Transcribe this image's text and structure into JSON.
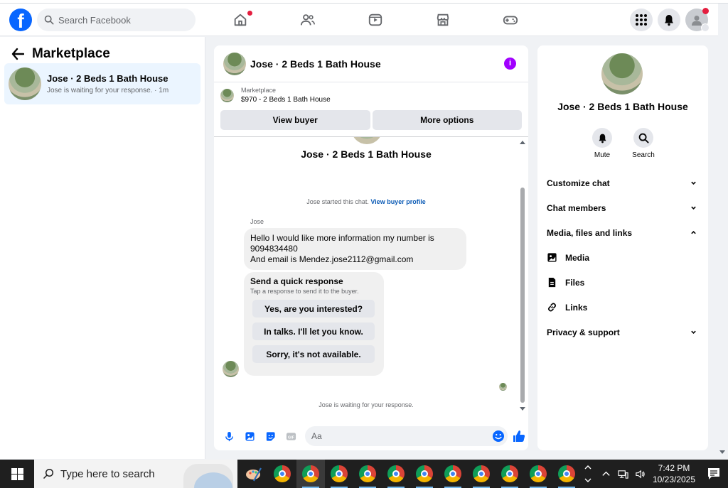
{
  "topnav": {
    "logo": "f",
    "search_placeholder": "Search Facebook"
  },
  "left": {
    "title": "Marketplace",
    "chat_item": {
      "title": "Jose · 2 Beds 1 Bath House",
      "subtitle": "Jose is waiting for your response. · 1m"
    }
  },
  "center": {
    "header_title": "Jose · 2 Beds 1 Bath House",
    "info_icon": "i",
    "listing_label": "Marketplace",
    "listing_price": "$970 - 2 Beds 1 Bath House",
    "view_buyer": "View buyer",
    "more_options": "More options",
    "conversation_name": "Jose · 2 Beds 1 Bath House",
    "started_text": "Jose started this chat.",
    "view_buyer_profile": "View buyer profile",
    "sender_name": "Jose",
    "message_lines": [
      "Hello I would like more information my number is",
      "9094834480",
      "And email is Mendez.jose2112@gmail.com"
    ],
    "quick_title": "Send a quick response",
    "quick_sub": "Tap a response to send it to the buyer.",
    "quick_replies": [
      "Yes, are you interested?",
      "In talks. I'll let you know.",
      "Sorry, it's not available."
    ],
    "waiting_text": "Jose is waiting for your response.",
    "composer_placeholder": "Aa"
  },
  "right": {
    "title": "Jose · 2 Beds 1 Bath House",
    "mute": "Mute",
    "search": "Search",
    "menu": {
      "customize": "Customize chat",
      "members": "Chat members",
      "media_files": "Media, files and links",
      "media": "Media",
      "files": "Files",
      "links": "Links",
      "privacy": "Privacy & support"
    }
  },
  "taskbar": {
    "search_placeholder": "Type here to search",
    "time": "7:42 PM",
    "date": "10/23/2025"
  },
  "colors": {
    "brand": "#0866ff",
    "accent_purple": "#a100ff",
    "selected_bg": "#ebf5ff",
    "notification_red": "#e41e3f"
  }
}
